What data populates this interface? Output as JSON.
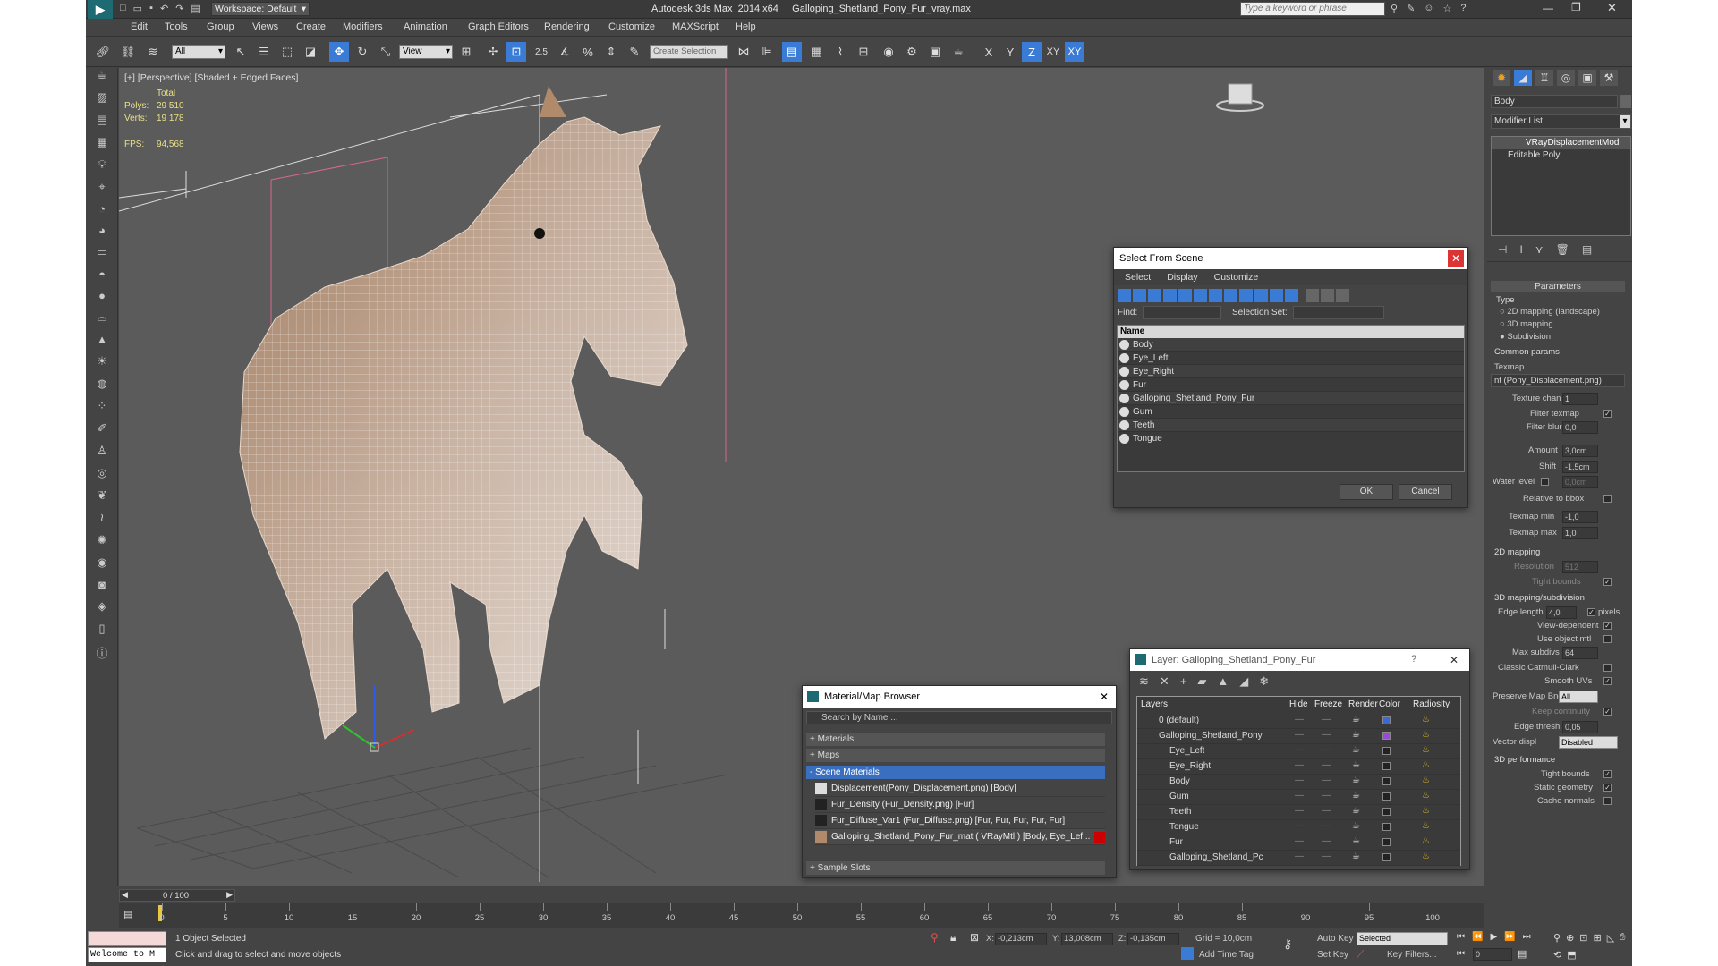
{
  "app": {
    "title": "Autodesk 3ds Max  2014 x64     Galloping_Shetland_Pony_Fur_vray.max",
    "workspace": "Workspace: Default",
    "search_placeholder": "Type a keyword or phrase"
  },
  "menu": [
    "Edit",
    "Tools",
    "Group",
    "Views",
    "Create",
    "Modifiers",
    "Animation",
    "Graph Editors",
    "Rendering",
    "Customize",
    "MAXScript",
    "Help"
  ],
  "toolbar": {
    "filter": "All",
    "coord_system": "View",
    "selection_set": "Create Selection Se",
    "snaps": "2.5",
    "axes": [
      "X",
      "Y",
      "Z",
      "XY",
      "XY"
    ]
  },
  "viewport": {
    "label": "[+] [Perspective] [Shaded + Edged Faces]",
    "stats_total": "Total",
    "polys_label": "Polys:",
    "polys_value": "29 510",
    "verts_label": "Verts:",
    "verts_value": "19 178",
    "fps_label": "FPS:",
    "fps_value": "94,568"
  },
  "select_from_scene": {
    "title": "Select From Scene",
    "tabs": [
      "Select",
      "Display",
      "Customize"
    ],
    "find_label": "Find:",
    "selection_set_label": "Selection Set:",
    "column": "Name",
    "items": [
      "Body",
      "Eye_Left",
      "Eye_Right",
      "Fur",
      "Galloping_Shetland_Pony_Fur",
      "Gum",
      "Teeth",
      "Tongue"
    ],
    "ok": "OK",
    "cancel": "Cancel"
  },
  "layer_window": {
    "title": "Layer: Galloping_Shetland_Pony_Fur",
    "help": "?",
    "columns": [
      "Layers",
      "Hide",
      "Freeze",
      "Render",
      "Color",
      "Radiosity"
    ],
    "rows": [
      {
        "name": "0 (default)",
        "color": "#3a6ad4"
      },
      {
        "name": "Galloping_Shetland_Pony",
        "color": "#9a4ad8"
      },
      {
        "name": "Eye_Left",
        "color": "#222222"
      },
      {
        "name": "Eye_Right",
        "color": "#222222"
      },
      {
        "name": "Body",
        "color": "#222222"
      },
      {
        "name": "Gum",
        "color": "#222222"
      },
      {
        "name": "Teeth",
        "color": "#222222"
      },
      {
        "name": "Tongue",
        "color": "#222222"
      },
      {
        "name": "Fur",
        "color": "#222222"
      },
      {
        "name": "Galloping_Shetland_Pc",
        "color": "#222222"
      }
    ]
  },
  "material_browser": {
    "title": "Material/Map Browser",
    "search_placeholder": "Search by Name ...",
    "sections": [
      "+ Materials",
      "+ Maps",
      "- Scene Materials",
      "+ Sample Slots"
    ],
    "materials": [
      "Displacement(Pony_Displacement.png) [Body]",
      "Fur_Density (Fur_Density.png)  [Fur]",
      "Fur_Diffuse_Var1 (Fur_Diffuse.png)  [Fur, Fur, Fur, Fur, Fur]",
      "Galloping_Shetland_Pony_Fur_mat  ( VRayMtl )  [Body, Eye_Lef..."
    ]
  },
  "command_panel": {
    "object_name": "Body",
    "modifier_list": "Modifier List",
    "stack": [
      "VRayDisplacementMod",
      "Editable Poly"
    ],
    "rollout_title": "Parameters",
    "type_label": "Type",
    "types": [
      "2D mapping (landscape)",
      "3D mapping",
      "Subdivision"
    ],
    "common_params": "Common params",
    "texmap_label": "Texmap",
    "texmap_value": "nt (Pony_Displacement.png)",
    "texture_chan_label": "Texture chan",
    "texture_chan": "1",
    "filter_texmap": "Filter texmap",
    "filter_blur_label": "Filter blur",
    "filter_blur": "0,0",
    "amount_label": "Amount",
    "amount": "3,0cm",
    "shift_label": "Shift",
    "shift": "-1,5cm",
    "water_level_label": "Water level",
    "water_level": "0,0cm",
    "relative_bbox": "Relative to bbox",
    "texmap_min_label": "Texmap min",
    "texmap_min": "-1,0",
    "texmap_max_label": "Texmap max",
    "texmap_max": "1,0",
    "mapping2d": "2D mapping",
    "resolution_label": "Resolution",
    "resolution": "512",
    "tight_bounds": "Tight bounds",
    "mapping3d": "3D mapping/subdivision",
    "edge_length_label": "Edge length",
    "edge_length": "4,0",
    "pixels": "pixels",
    "view_dependent": "View-dependent",
    "use_object_mtl": "Use object mtl",
    "max_subdivs_label": "Max subdivs",
    "max_subdivs": "64",
    "classic_catmull": "Classic Catmull-Clark",
    "smooth_uvs": "Smooth UVs",
    "preserve_map_bnd_label": "Preserve Map Bnd",
    "preserve_map_bnd": "All",
    "keep_continuity": "Keep continuity",
    "edge_thresh_label": "Edge thresh",
    "edge_thresh": "0,05",
    "vector_displ_label": "Vector displ",
    "vector_displ": "Disabled",
    "performance": "3D performance",
    "tight_bounds2": "Tight bounds",
    "static_geometry": "Static geometry",
    "cache_normals": "Cache normals"
  },
  "timeline": {
    "frame": "0 / 100",
    "ticks": [
      "0",
      "5",
      "10",
      "15",
      "20",
      "25",
      "30",
      "35",
      "40",
      "45",
      "50",
      "55",
      "60",
      "65",
      "70",
      "75",
      "80",
      "85",
      "90",
      "95",
      "100"
    ]
  },
  "status": {
    "maxscript": "Welcome to M",
    "selected": "1 Object Selected",
    "prompt": "Click and drag to select and move objects",
    "x_label": "X:",
    "x": "-0,213cm",
    "y_label": "Y:",
    "y": "13,008cm",
    "z_label": "Z:",
    "z": "-0,135cm",
    "grid": "Grid = 10,0cm",
    "add_time_tag": "Add Time Tag",
    "auto_key": "Auto Key",
    "set_key": "Set Key",
    "key_mode": "Selected",
    "key_filters": "Key Filters...",
    "current_frame": "0"
  }
}
